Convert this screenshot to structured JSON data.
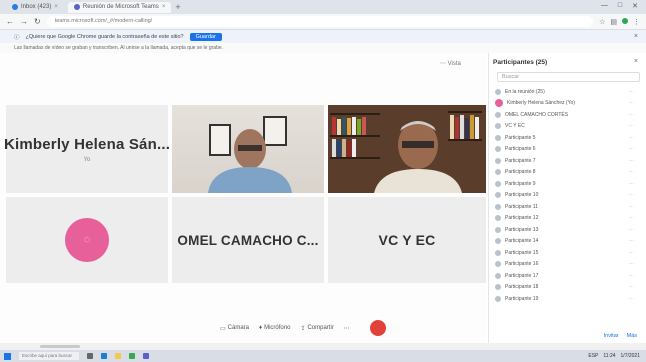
{
  "browser": {
    "tabs": [
      {
        "label": "Inbox (423)"
      },
      {
        "label": "Reunión de Microsoft Teams"
      }
    ],
    "new_tab": "+",
    "window_controls": [
      "—",
      "□",
      "✕"
    ],
    "url": "teams.microsoft.com/_#/modern-calling/",
    "info_bar": {
      "text": "¿Quiere que Google Chrome guarde la contraseña de este sitio?",
      "button": "Guardar",
      "close": "×"
    },
    "banner": "Las llamadas de vídeo se graban y transcriben. Al unirse a la llamada, acepta que se le grabe."
  },
  "meeting": {
    "tiles": [
      {
        "name": "Kimberly Helena Sán...",
        "sub": "Yo"
      },
      {
        "name": "OMEL CAMACHO C..."
      },
      {
        "name": "VC Y EC"
      }
    ],
    "pane_menu": "⋯ Vista",
    "toolbar": {
      "camera": "Cámara",
      "mic": "Micrófono",
      "share": "Compartir",
      "more": "⋯"
    }
  },
  "participants": {
    "title": "Participantes (25)",
    "close": "×",
    "search_placeholder": "Buscar",
    "items": [
      {
        "name": "En la reunión (25)"
      },
      {
        "name": "Kimberly Helena Sánchez (Yo)"
      },
      {
        "name": "OMEL CAMACHO CORTÉS"
      },
      {
        "name": "VC Y EC"
      },
      {
        "name": "Participante 5"
      },
      {
        "name": "Participante 6"
      },
      {
        "name": "Participante 7"
      },
      {
        "name": "Participante 8"
      },
      {
        "name": "Participante 9"
      },
      {
        "name": "Participante 10"
      },
      {
        "name": "Participante 11"
      },
      {
        "name": "Participante 12"
      },
      {
        "name": "Participante 13"
      },
      {
        "name": "Participante 14"
      },
      {
        "name": "Participante 15"
      },
      {
        "name": "Participante 16"
      },
      {
        "name": "Participante 17"
      },
      {
        "name": "Participante 18"
      },
      {
        "name": "Participante 19"
      }
    ],
    "footer": {
      "invite": "Invitar",
      "more": "Más"
    }
  },
  "taskbar": {
    "search": "Escribe aquí para buscar",
    "tray": [
      "ESP",
      "11:24",
      "1/7/2021"
    ]
  }
}
